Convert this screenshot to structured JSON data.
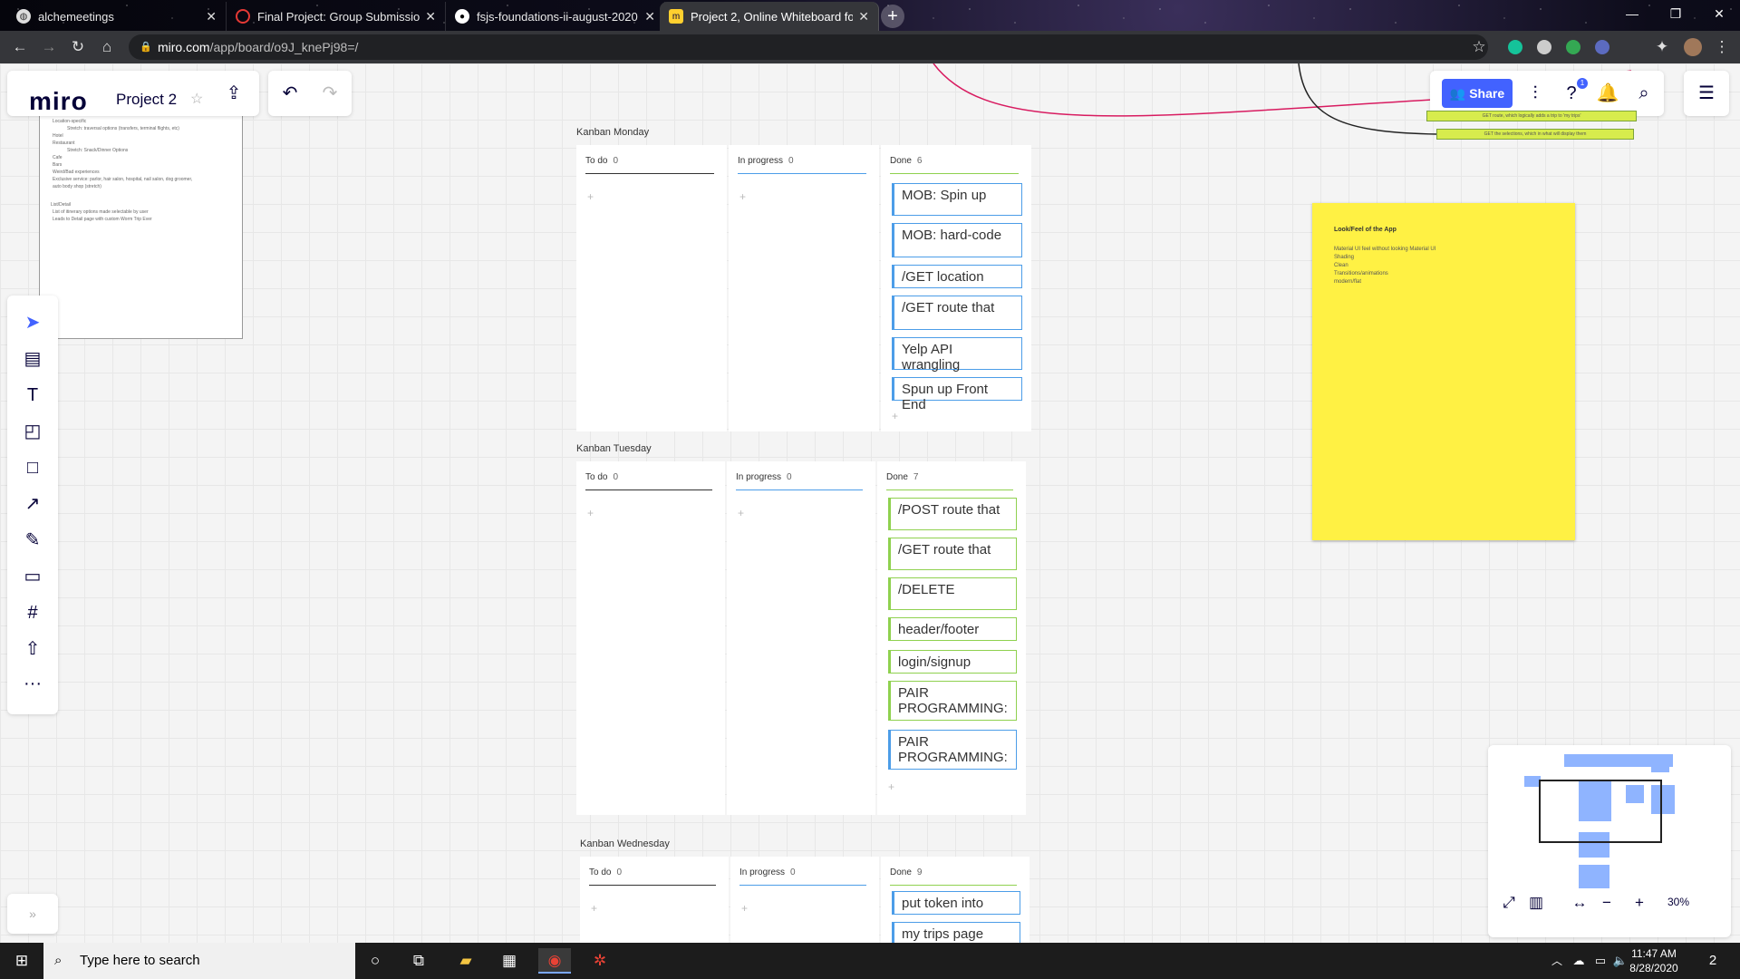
{
  "browser": {
    "tabs": [
      {
        "title": "alchemeetings",
        "active": false
      },
      {
        "title": "Final Project: Group Submission -",
        "active": false
      },
      {
        "title": "fsjs-foundations-ii-august-2020",
        "active": false
      },
      {
        "title": "Project 2, Online Whiteboard fo",
        "active": true
      }
    ],
    "url_host": "miro.com",
    "url_path": "/app/board/o9J_knePj98=/"
  },
  "miro": {
    "logo": "miro",
    "project_title": "Project 2",
    "share_label": "Share",
    "help_badge": "1",
    "zoom": "30%"
  },
  "boards": [
    {
      "label": "Kanban Monday",
      "columns": [
        {
          "name": "To do",
          "count": "0",
          "cards": []
        },
        {
          "name": "In progress",
          "count": "0",
          "cards": []
        },
        {
          "name": "Done",
          "count": "6",
          "cards": [
            "MOB: Spin up",
            "MOB: hard-code",
            "/GET location",
            "/GET route that",
            "Yelp API wrangling",
            "Spun up Front End"
          ]
        }
      ]
    },
    {
      "label": "Kanban Tuesday",
      "columns": [
        {
          "name": "To do",
          "count": "0",
          "cards": []
        },
        {
          "name": "In progress",
          "count": "0",
          "cards": []
        },
        {
          "name": "Done",
          "count": "7",
          "cards": [
            "/POST route that",
            "/GET route that",
            "/DELETE",
            "header/footer",
            "login/signup",
            "PAIR PROGRAMMING:",
            "PAIR PROGRAMMING:"
          ]
        }
      ]
    },
    {
      "label": "Kanban Wednesday",
      "columns": [
        {
          "name": "To do",
          "count": "0",
          "cards": []
        },
        {
          "name": "In progress",
          "count": "0",
          "cards": []
        },
        {
          "name": "Done",
          "count": "9",
          "cards": [
            "put token into",
            "my trips page"
          ]
        }
      ]
    }
  ],
  "sticky": {
    "title": "Look/Feel of the App",
    "lines": [
      "Material UI feel without looking Material UI",
      "Shading",
      "Clean",
      "Transitions/animations",
      "modern/flat"
    ]
  },
  "doc_lines": [
    "Location-specific",
    "Stretch: traversal options (transfers, terminal flights, etc)",
    "Hotel",
    "Restaurant",
    "Stretch: Snack/Dinner Options",
    "Cafe",
    "Bars",
    "Weird/Bad experiences",
    "Exclusive service: parlor, hair salon, hospital, nail salon, dog groomer,",
    "auto body shop (stretch)",
    "List/Detail",
    "List of itinerary options made selectable by user",
    "Leads to Detail page with custom Worm Trip Ever"
  ],
  "green_notes": [
    "GET route, which logically adds a trip to 'my trips'",
    "GET the selections, which in what will display them"
  ],
  "taskbar": {
    "search_placeholder": "Type here to search",
    "time": "11:47 AM",
    "date": "8/28/2020",
    "notifications": "2"
  },
  "colors": {
    "accent": "#4262ff",
    "sticky": "#fff144",
    "card_blue": "#4c9de8",
    "card_green": "#8fd14f"
  }
}
